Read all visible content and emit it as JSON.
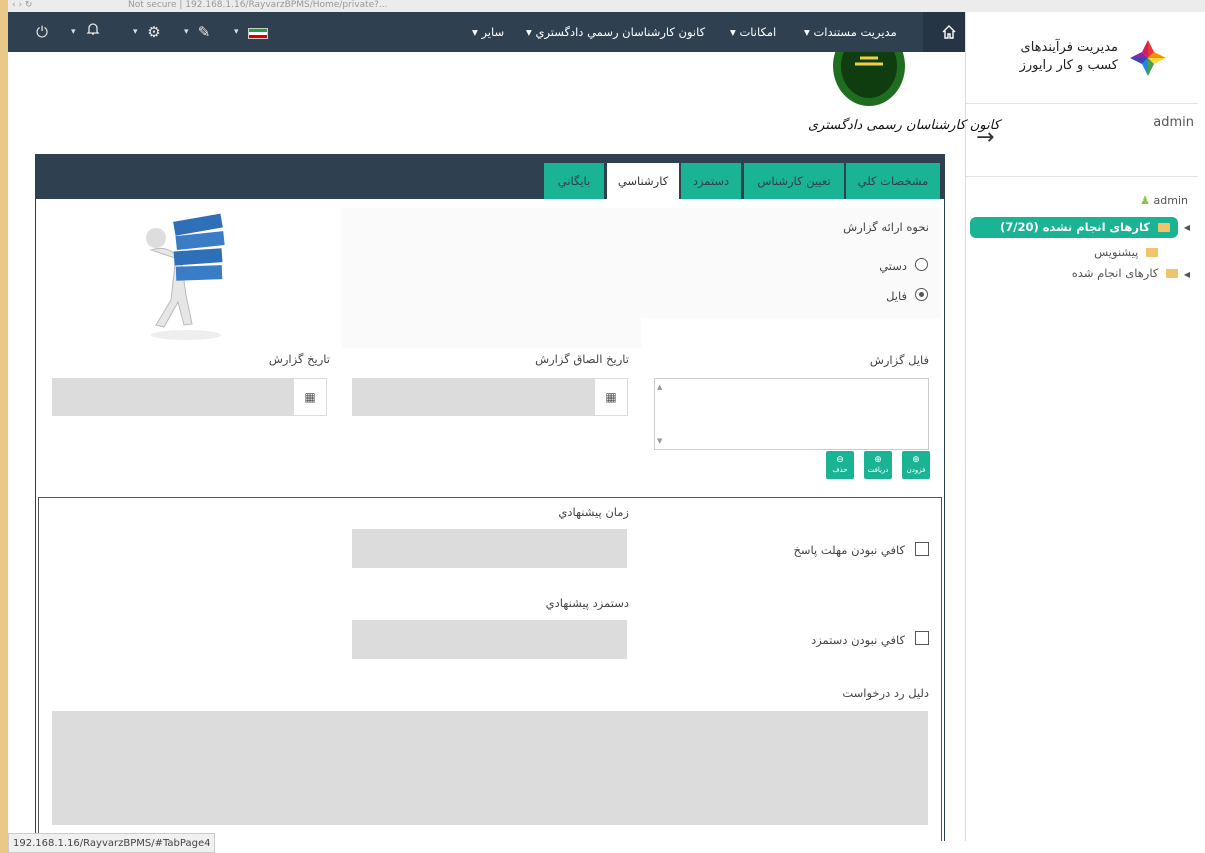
{
  "topbar": {
    "home_icon": "home-icon",
    "menus": [
      "مديريت مستندات",
      "امکانات",
      "کانون کارشناسان رسمي دادگستري",
      "ساير"
    ],
    "icons": [
      "power-icon",
      "bell-icon",
      "gear-icon",
      "pen-icon",
      "flag-icon"
    ],
    "flag_colors": [
      "#239f40",
      "#ffffff",
      "#da0000"
    ]
  },
  "sidebar": {
    "logo_line1": "مدیریت فرآیندهای",
    "logo_line2": "کسب و کار رایورز",
    "user": "admin",
    "tree_user": "admin",
    "tree_active": "کارهای انجام نشده (7/20)",
    "tree_draft": "پيشنويس",
    "tree_done": "کارهای انجام شده"
  },
  "emblem": {
    "text": "کانون کارشناسان رسمی دادگستری"
  },
  "tabs": [
    "مشخصات کلي",
    "تعيين کارشناس",
    "دستمزد",
    "کارشناسي",
    "بايگاني"
  ],
  "form": {
    "report_method_label": "نحوه ارائه گزارش",
    "opt_manual": "دستي",
    "opt_file": "فايل",
    "report_file_label": "فايل گزارش",
    "attach_date_label": "تاريخ الصاق گزارش",
    "report_date_label": "تاريخ گزارش",
    "btn_upload": "فزودن",
    "btn_download": "دريافت",
    "btn_delete": "حذف",
    "suggest_time_label": "زمان پيشنهادي",
    "insufficient_time": "کافي نبودن مهلت پاسخ",
    "suggest_fee_label": "دستمزد پيشنهادي",
    "insufficient_fee": "کافي نبودن دستمزد",
    "reject_reason_label": "دليل رد درخواست"
  },
  "status_url": "192.168.1.16/RayvarzBPMS/#TabPage4",
  "browser": {
    "url": "Not secure | 192.168.1.16/RayvarzBPMS/Home/private?..."
  }
}
